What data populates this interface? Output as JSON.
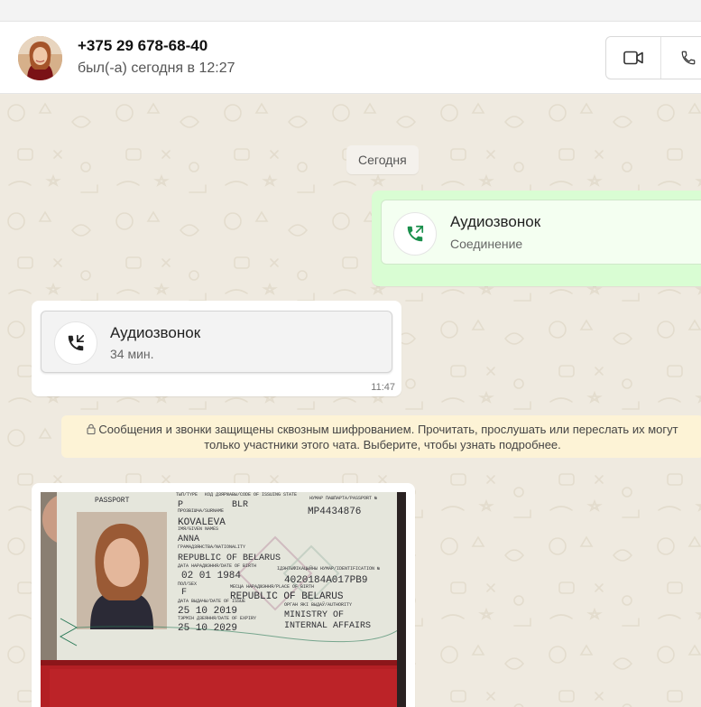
{
  "header": {
    "contact_name": "+375 29 678-68-40",
    "status": "был(-а) сегодня в 12:27",
    "video_call_icon": "video-camera-icon",
    "voice_call_icon": "phone-icon"
  },
  "chat": {
    "date_separator": "Сегодня",
    "messages": [
      {
        "direction": "outgoing",
        "type": "audio-call",
        "title": "Аудиозвонок",
        "subtitle": "Соединение",
        "icon": "outgoing-call-icon"
      },
      {
        "direction": "incoming",
        "type": "audio-call",
        "title": "Аудиозвонок",
        "subtitle": "34 мин.",
        "time": "11:47",
        "icon": "incoming-call-icon"
      }
    ],
    "encryption_notice_line1": "Сообщения и звонки защищены сквозным шифрованием. Прочитать, прослушать или переслать их могут",
    "encryption_notice_line2": "только участники этого чата. Выберите, чтобы узнать подробнее.",
    "image_message": {
      "passport": {
        "header_left": "PASSPORT",
        "type_label": "ТЫП/TYPE",
        "type": "P",
        "code_label": "КОД ДЗЯРЖАВЫ/CODE OF ISSUING STATE",
        "code": "BLR",
        "number_label": "НУМАР ПАШПАРТА/PASSPORT №",
        "number": "MP4434876",
        "surname_label": "ПРОЗВІШЧА/SURNAME",
        "surname": "KOVALEVA",
        "given_label": "ІМЯ/GIVEN NAMES",
        "given": "ANNA",
        "nationality_label": "ГРАМАДЗЯНСТВА/NATIONALITY",
        "nationality": "REPUBLIC OF BELARUS",
        "dob_label": "ДАТА НАРАДЖЭННЯ/DATE OF BIRTH",
        "dob": "02 01 1984",
        "idnum_label": "ІДЭНТЫФІКАЦЫЙНЫ НУМАР/IDENTIFICATION №",
        "idnum": "4020184A017PB9",
        "sex_label": "ПОЛ/SEX",
        "sex": "F",
        "pob_label": "МЕСЦА НАРАДЖЭННЯ/PLACE OF BIRTH",
        "pob": "REPUBLIC OF BELARUS",
        "issue_label": "ДАТА ВЫДАЧЫ/DATE OF ISSUE",
        "issue": "25 10 2019",
        "authority_label": "ОРГАН ЯКІ ВЫДАЎ/AUTHORITY",
        "authority1": "MINISTRY OF",
        "authority2": "INTERNAL AFFAIRS",
        "expiry_label": "ТЭРМІН ДЗЕЯННЯ/DATE OF EXPIRY",
        "expiry": "25 10 2029"
      }
    }
  },
  "colors": {
    "outgoing_bubble": "#d9fdd3",
    "incoming_bubble": "#ffffff",
    "call_icon_green": "#1a8f4c",
    "encryption_bg": "#fdf3d6",
    "passport_cover": "#b31f24"
  }
}
